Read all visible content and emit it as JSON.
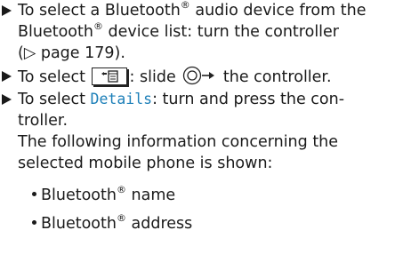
{
  "steps": [
    {
      "line1": "To select a Bluetooth",
      "line1_reg": "®",
      "line1_after": " audio device from the",
      "line2_a": "Bluetooth",
      "line2_reg": "®",
      "line2_b": " device list: turn the controller",
      "line3": "(▷ page 179)."
    },
    {
      "pre": "To select ",
      "post": ": slide ",
      "post2": " the controller."
    },
    {
      "pre": "To select ",
      "link": "Details",
      "post": ": turn and press the con-",
      "line2": "troller.",
      "line3": "The following information concerning the",
      "line4": "selected mobile phone is shown:"
    }
  ],
  "bullets": [
    {
      "name": "Bluetooth",
      "reg": "®",
      "suffix": " name"
    },
    {
      "name": "Bluetooth",
      "reg": "®",
      "suffix": " address"
    }
  ],
  "colors": {
    "text": "#1a1a1a",
    "menu_item": "#1c7fb8"
  },
  "icons": {
    "step_marker": "right-triangle-icon",
    "menu_key": "menu-button-icon",
    "controller": "controller-slide-right-icon"
  }
}
